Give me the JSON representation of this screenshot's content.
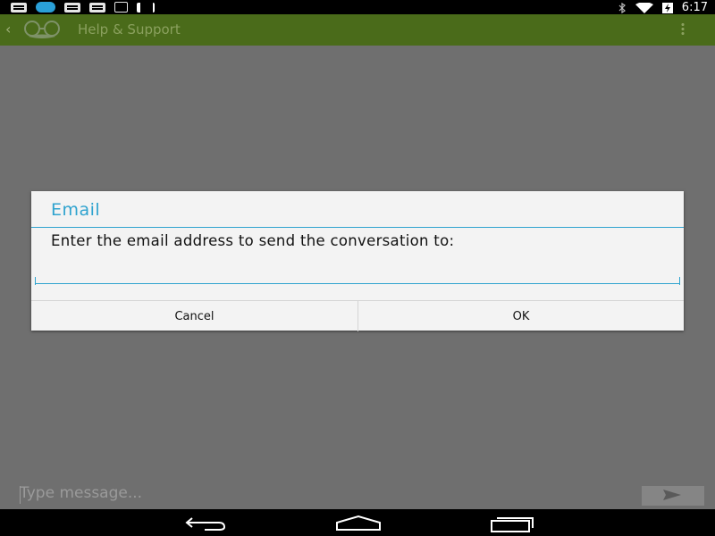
{
  "status_bar": {
    "left_icons": [
      "message-icon",
      "sync-icon",
      "message-icon",
      "message-icon",
      "download-icon",
      "barcode-icon"
    ],
    "right_icons": [
      "bluetooth-icon",
      "wifi-icon",
      "battery-charging-icon"
    ],
    "time": "6:17"
  },
  "action_bar": {
    "title": "Help & Support",
    "color": "#4a6b1a"
  },
  "dialog": {
    "title": "Email",
    "message": "Enter the email address to send the conversation to:",
    "input_value": "",
    "cancel_label": "Cancel",
    "ok_label": "OK",
    "accent_color": "#2fa3cf"
  },
  "compose": {
    "placeholder": "Type message..."
  },
  "nav_bar": {
    "icons": [
      "back-icon",
      "home-icon",
      "recent-apps-icon"
    ]
  }
}
